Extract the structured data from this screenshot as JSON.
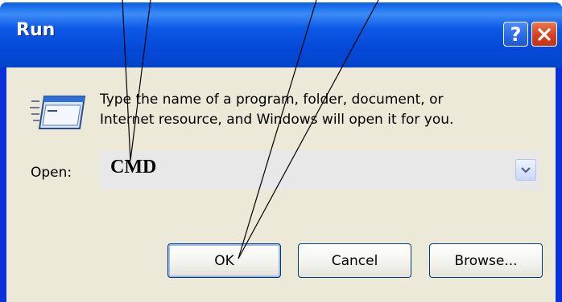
{
  "window": {
    "title": "Run",
    "help_icon": "help-icon",
    "close_icon": "close-icon",
    "help_glyph": "?"
  },
  "dialog": {
    "icon": "run-program-icon",
    "description_line1": "Type the name of a program, folder, document, or",
    "description_line2": "Internet resource, and Windows will open it for you.",
    "open_label": "Open:",
    "open_value": "CMD",
    "dropdown_icon": "chevron-down-icon"
  },
  "buttons": {
    "ok": "OK",
    "cancel": "Cancel",
    "browse": "Browse..."
  },
  "colors": {
    "titlebar": "#0549d8",
    "client": "#ece9d8",
    "close_button": "#d6401f",
    "annotation_lines": "#000000"
  }
}
